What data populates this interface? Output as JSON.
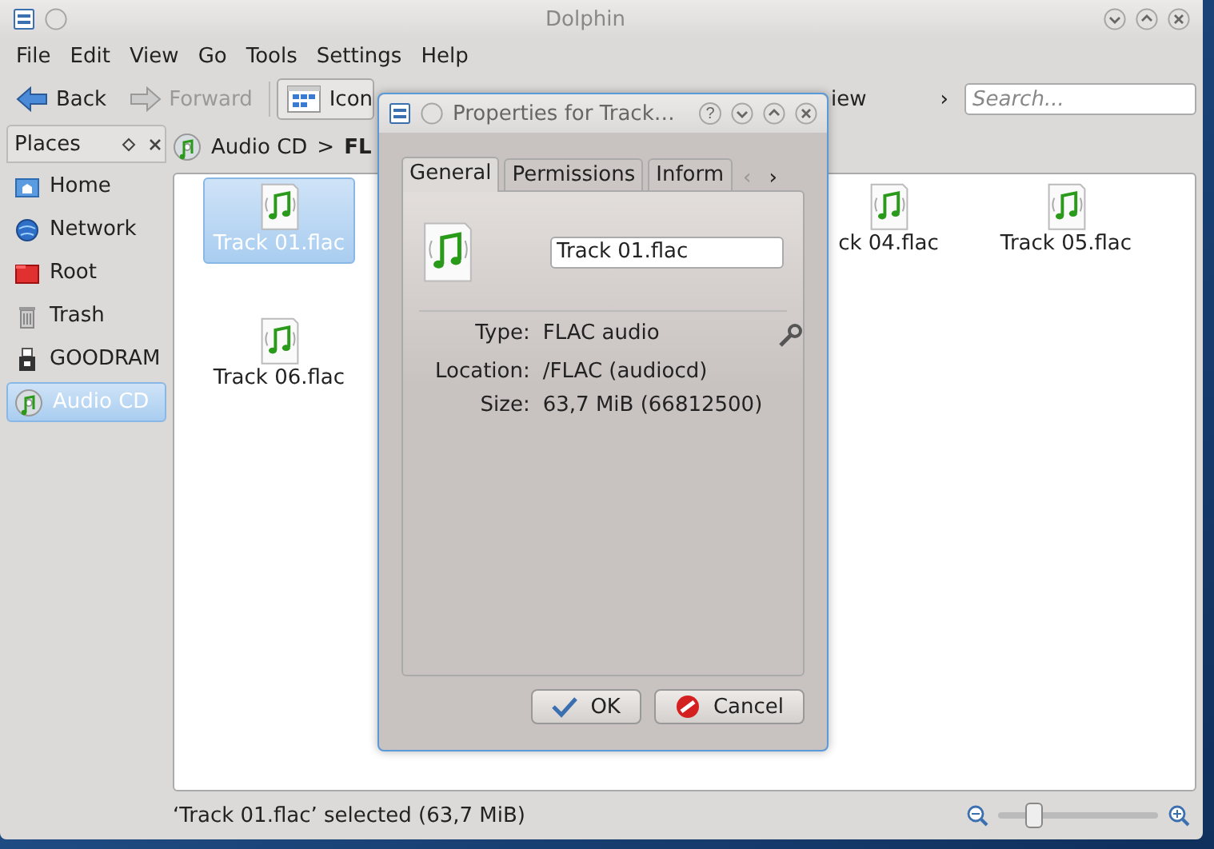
{
  "window": {
    "title": "Dolphin"
  },
  "menu": [
    "File",
    "Edit",
    "View",
    "Go",
    "Tools",
    "Settings",
    "Help"
  ],
  "toolbar": {
    "back": "Back",
    "forward": {
      "label": "Forward",
      "disabled": true
    },
    "view_mode": {
      "label": "Icon",
      "selected": true
    },
    "preview": "iew",
    "more": "›",
    "search": {
      "placeholder": "Search..."
    }
  },
  "places": {
    "title": "Places",
    "items": [
      {
        "label": "Home",
        "kind": "home",
        "selected": false
      },
      {
        "label": "Network",
        "kind": "network",
        "selected": false
      },
      {
        "label": "Root",
        "kind": "root",
        "selected": false
      },
      {
        "label": "Trash",
        "kind": "trash",
        "selected": false
      },
      {
        "label": "GOODRAM",
        "kind": "usb",
        "selected": false
      },
      {
        "label": "Audio CD",
        "kind": "cd",
        "selected": true
      }
    ]
  },
  "breadcrumb": {
    "items": [
      "Audio CD",
      "FL"
    ],
    "separator": ">"
  },
  "files": [
    {
      "name": "Track 01.flac",
      "selected": true
    },
    {
      "name": "ck 04.flac",
      "selected": false
    },
    {
      "name": "Track 05.flac",
      "selected": false
    },
    {
      "name": "Track 06.flac",
      "selected": false
    }
  ],
  "status_bar": {
    "text": "‘Track 01.flac’ selected (63,7 MiB)",
    "zoom": {
      "level": 0.22
    }
  },
  "dialog": {
    "title": "Properties for Track…",
    "help": "?",
    "tabs": [
      {
        "label": "General",
        "selected": true
      },
      {
        "label": "Permissions",
        "selected": false
      },
      {
        "label": "Inform",
        "selected": false
      }
    ],
    "tab_scroll": [
      "‹",
      "›"
    ],
    "name": "Track 01.flac",
    "fields": [
      {
        "label": "Type:",
        "value": "FLAC audio"
      },
      {
        "label": "Location:",
        "value": "/FLAC (audiocd)"
      },
      {
        "label": "Size:",
        "value": "63,7 MiB (66812500)"
      }
    ],
    "buttons": [
      {
        "label": "OK",
        "kind": "ok"
      },
      {
        "label": "Cancel",
        "kind": "cancel"
      }
    ]
  }
}
